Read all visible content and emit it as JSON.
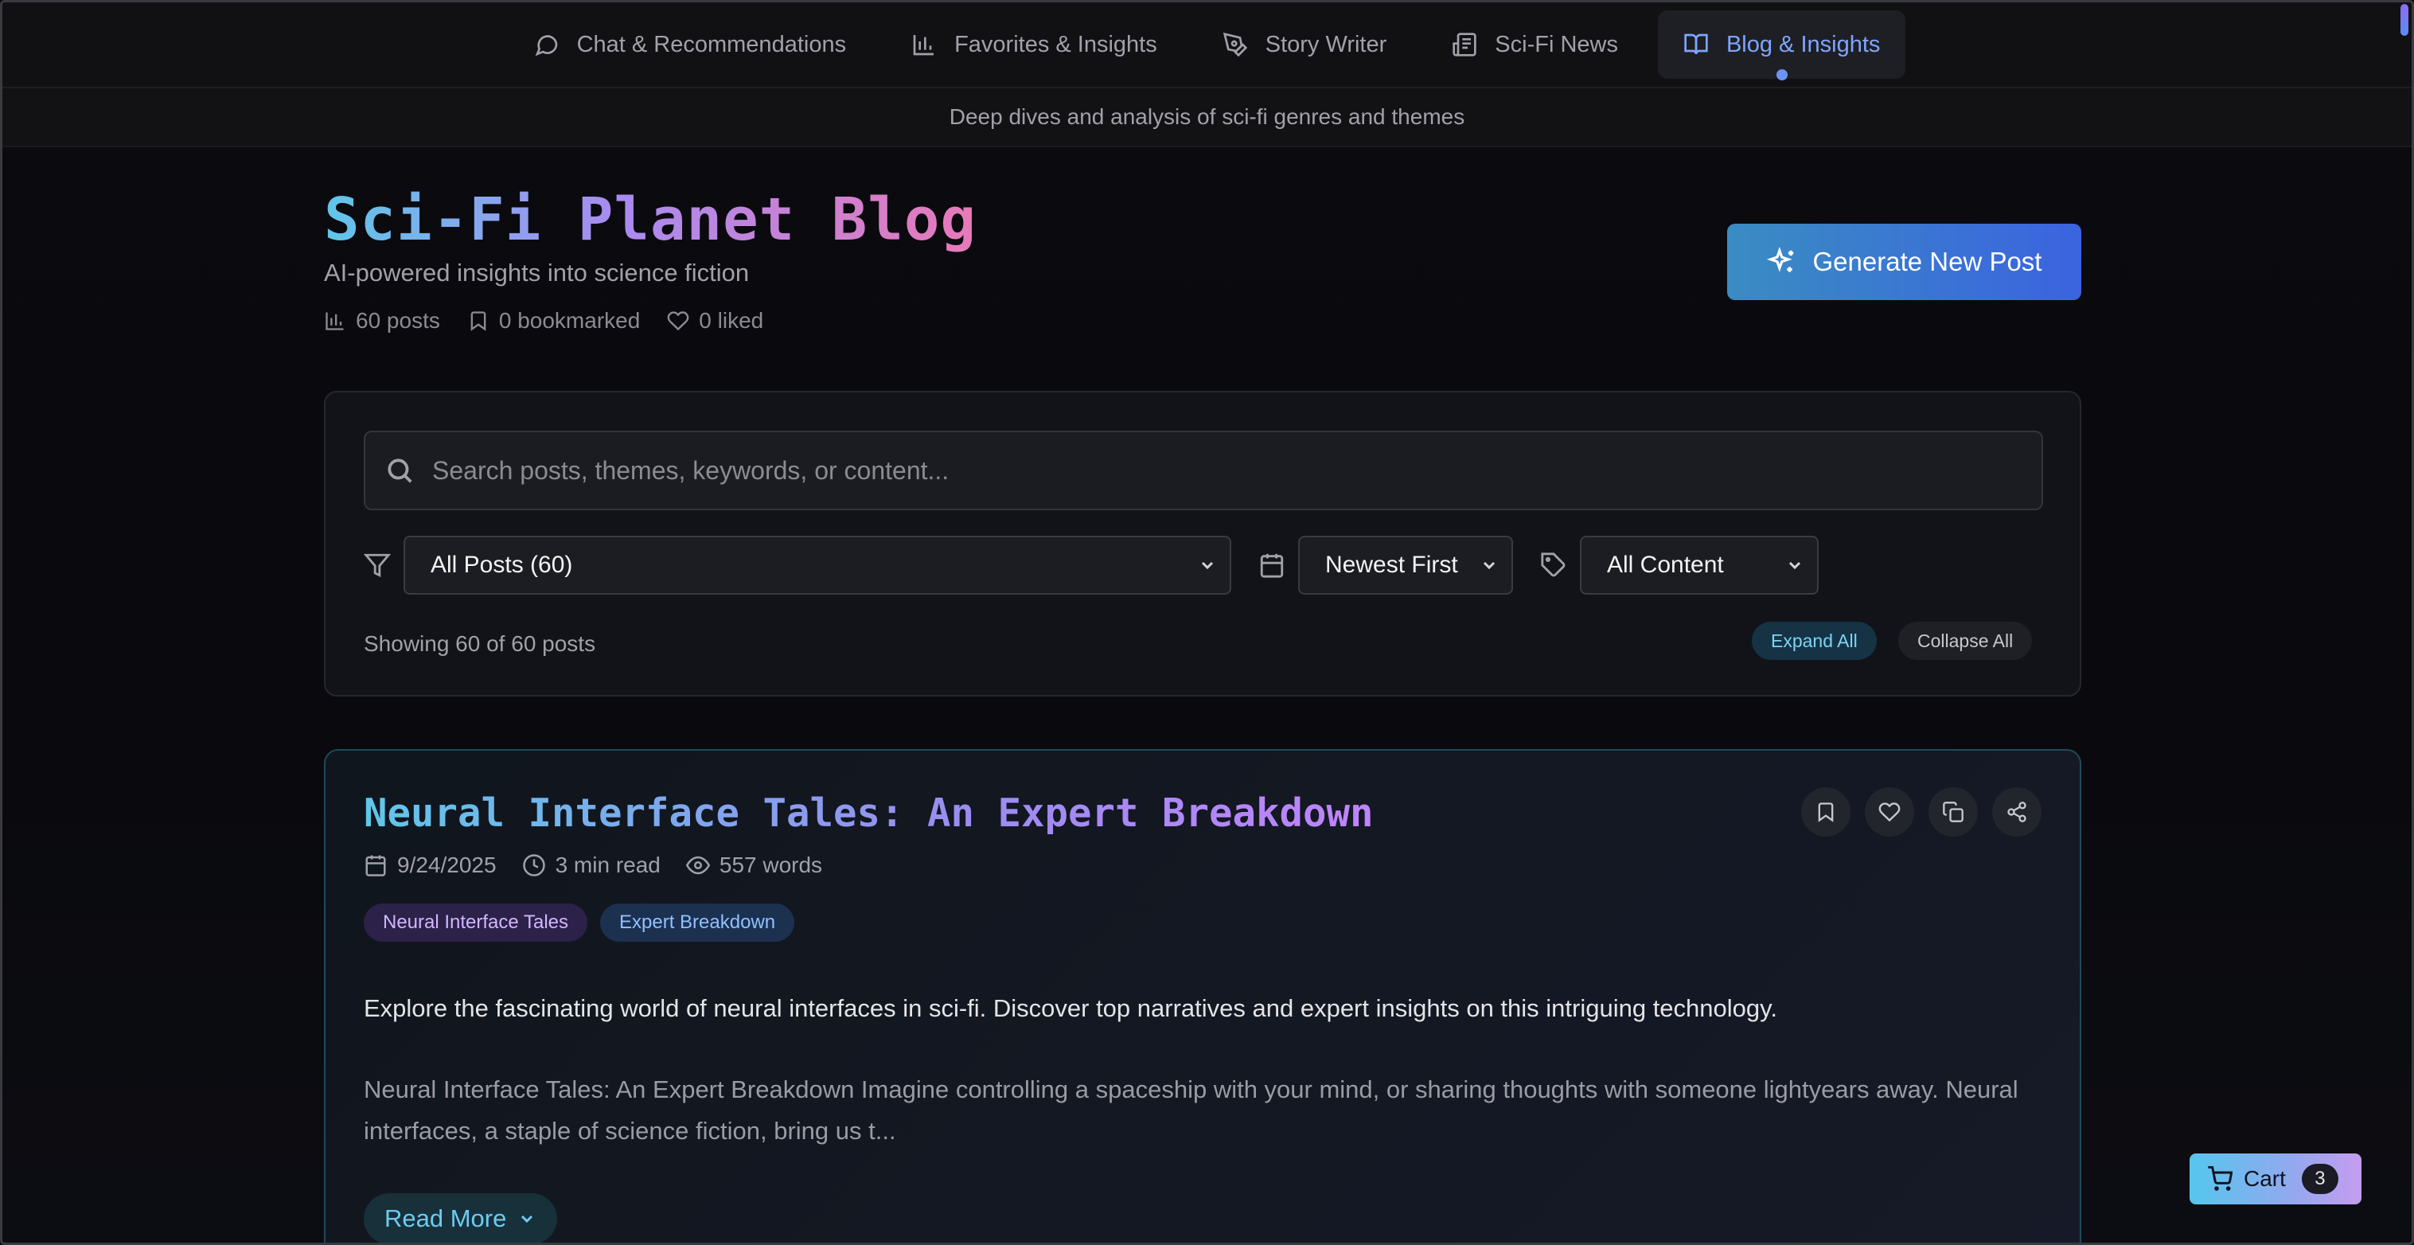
{
  "nav": {
    "tabs": [
      {
        "label": "Chat & Recommendations",
        "icon": "message-circle-icon"
      },
      {
        "label": "Favorites & Insights",
        "icon": "bar-chart-icon"
      },
      {
        "label": "Story Writer",
        "icon": "pen-tool-icon"
      },
      {
        "label": "Sci-Fi News",
        "icon": "newspaper-icon"
      },
      {
        "label": "Blog & Insights",
        "icon": "book-open-icon",
        "active": true
      }
    ],
    "subtitle": "Deep dives and analysis of sci-fi genres and themes"
  },
  "header": {
    "title": "Sci-Fi Planet Blog",
    "subtitle": "AI-powered insights into science fiction",
    "stats": {
      "posts": "60 posts",
      "bookmarked": "0 bookmarked",
      "liked": "0 liked"
    },
    "generate_label": "Generate New Post"
  },
  "filters": {
    "search_placeholder": "Search posts, themes, keywords, or content...",
    "category_selected": "All Posts (60)",
    "sort_selected": "Newest First",
    "content_selected": "All Content",
    "showing_text": "Showing 60 of 60 posts",
    "expand_label": "Expand All",
    "collapse_label": "Collapse All"
  },
  "post": {
    "title": "Neural Interface Tales: An Expert Breakdown",
    "date": "9/24/2025",
    "read_time": "3 min read",
    "words": "557 words",
    "tags": [
      "Neural Interface Tales",
      "Expert Breakdown"
    ],
    "excerpt": "Explore the fascinating world of neural interfaces in sci-fi. Discover top narratives and expert insights on this intriguing technology.",
    "body": "Neural Interface Tales: An Expert Breakdown Imagine controlling a spaceship with your mind, or sharing thoughts with someone lightyears away. Neural interfaces, a staple of science fiction, bring us t...",
    "read_more_label": "Read More"
  },
  "cart": {
    "label": "Cart",
    "count": "3"
  },
  "colors": {
    "accent_blue": "#6b93f5",
    "cyan": "#60c6ea",
    "purple": "#a98bf0",
    "pink": "#e879b9"
  }
}
